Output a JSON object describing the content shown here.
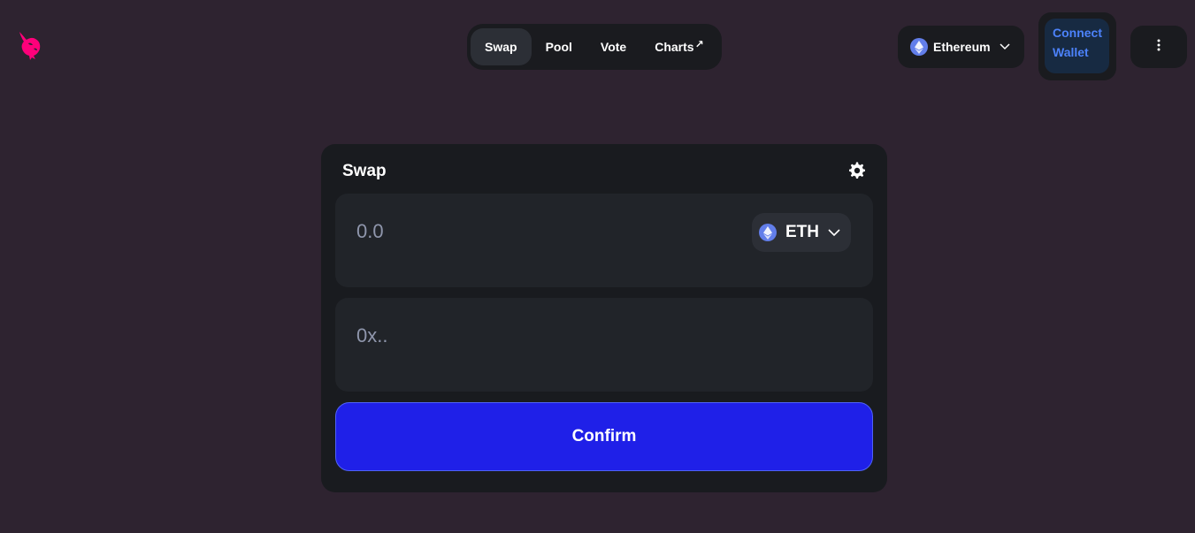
{
  "header": {
    "logo_icon": "uniswap-unicorn-icon",
    "nav": [
      {
        "label": "Swap",
        "active": true
      },
      {
        "label": "Pool",
        "active": false
      },
      {
        "label": "Vote",
        "active": false
      },
      {
        "label": "Charts",
        "external_icon": "↗",
        "active": false
      }
    ],
    "network": {
      "label": "Ethereum",
      "icon": "ethereum-icon"
    },
    "connect": {
      "line1": "Connect",
      "line2": "Wallet"
    },
    "menu_icon": "more-vertical-icon"
  },
  "swap": {
    "title": "Swap",
    "amount": {
      "value": "",
      "placeholder": "0.0"
    },
    "token": {
      "symbol": "ETH",
      "icon": "ethereum-icon"
    },
    "address": {
      "value": "",
      "placeholder": "0x.."
    },
    "confirm_label": "Confirm"
  },
  "colors": {
    "background": "#2e2330",
    "panel": "#191b1f",
    "field": "#212429",
    "accent_blue": "#1f20e8",
    "connect_text": "#4c82fb",
    "brand_pink": "#ff007a"
  }
}
